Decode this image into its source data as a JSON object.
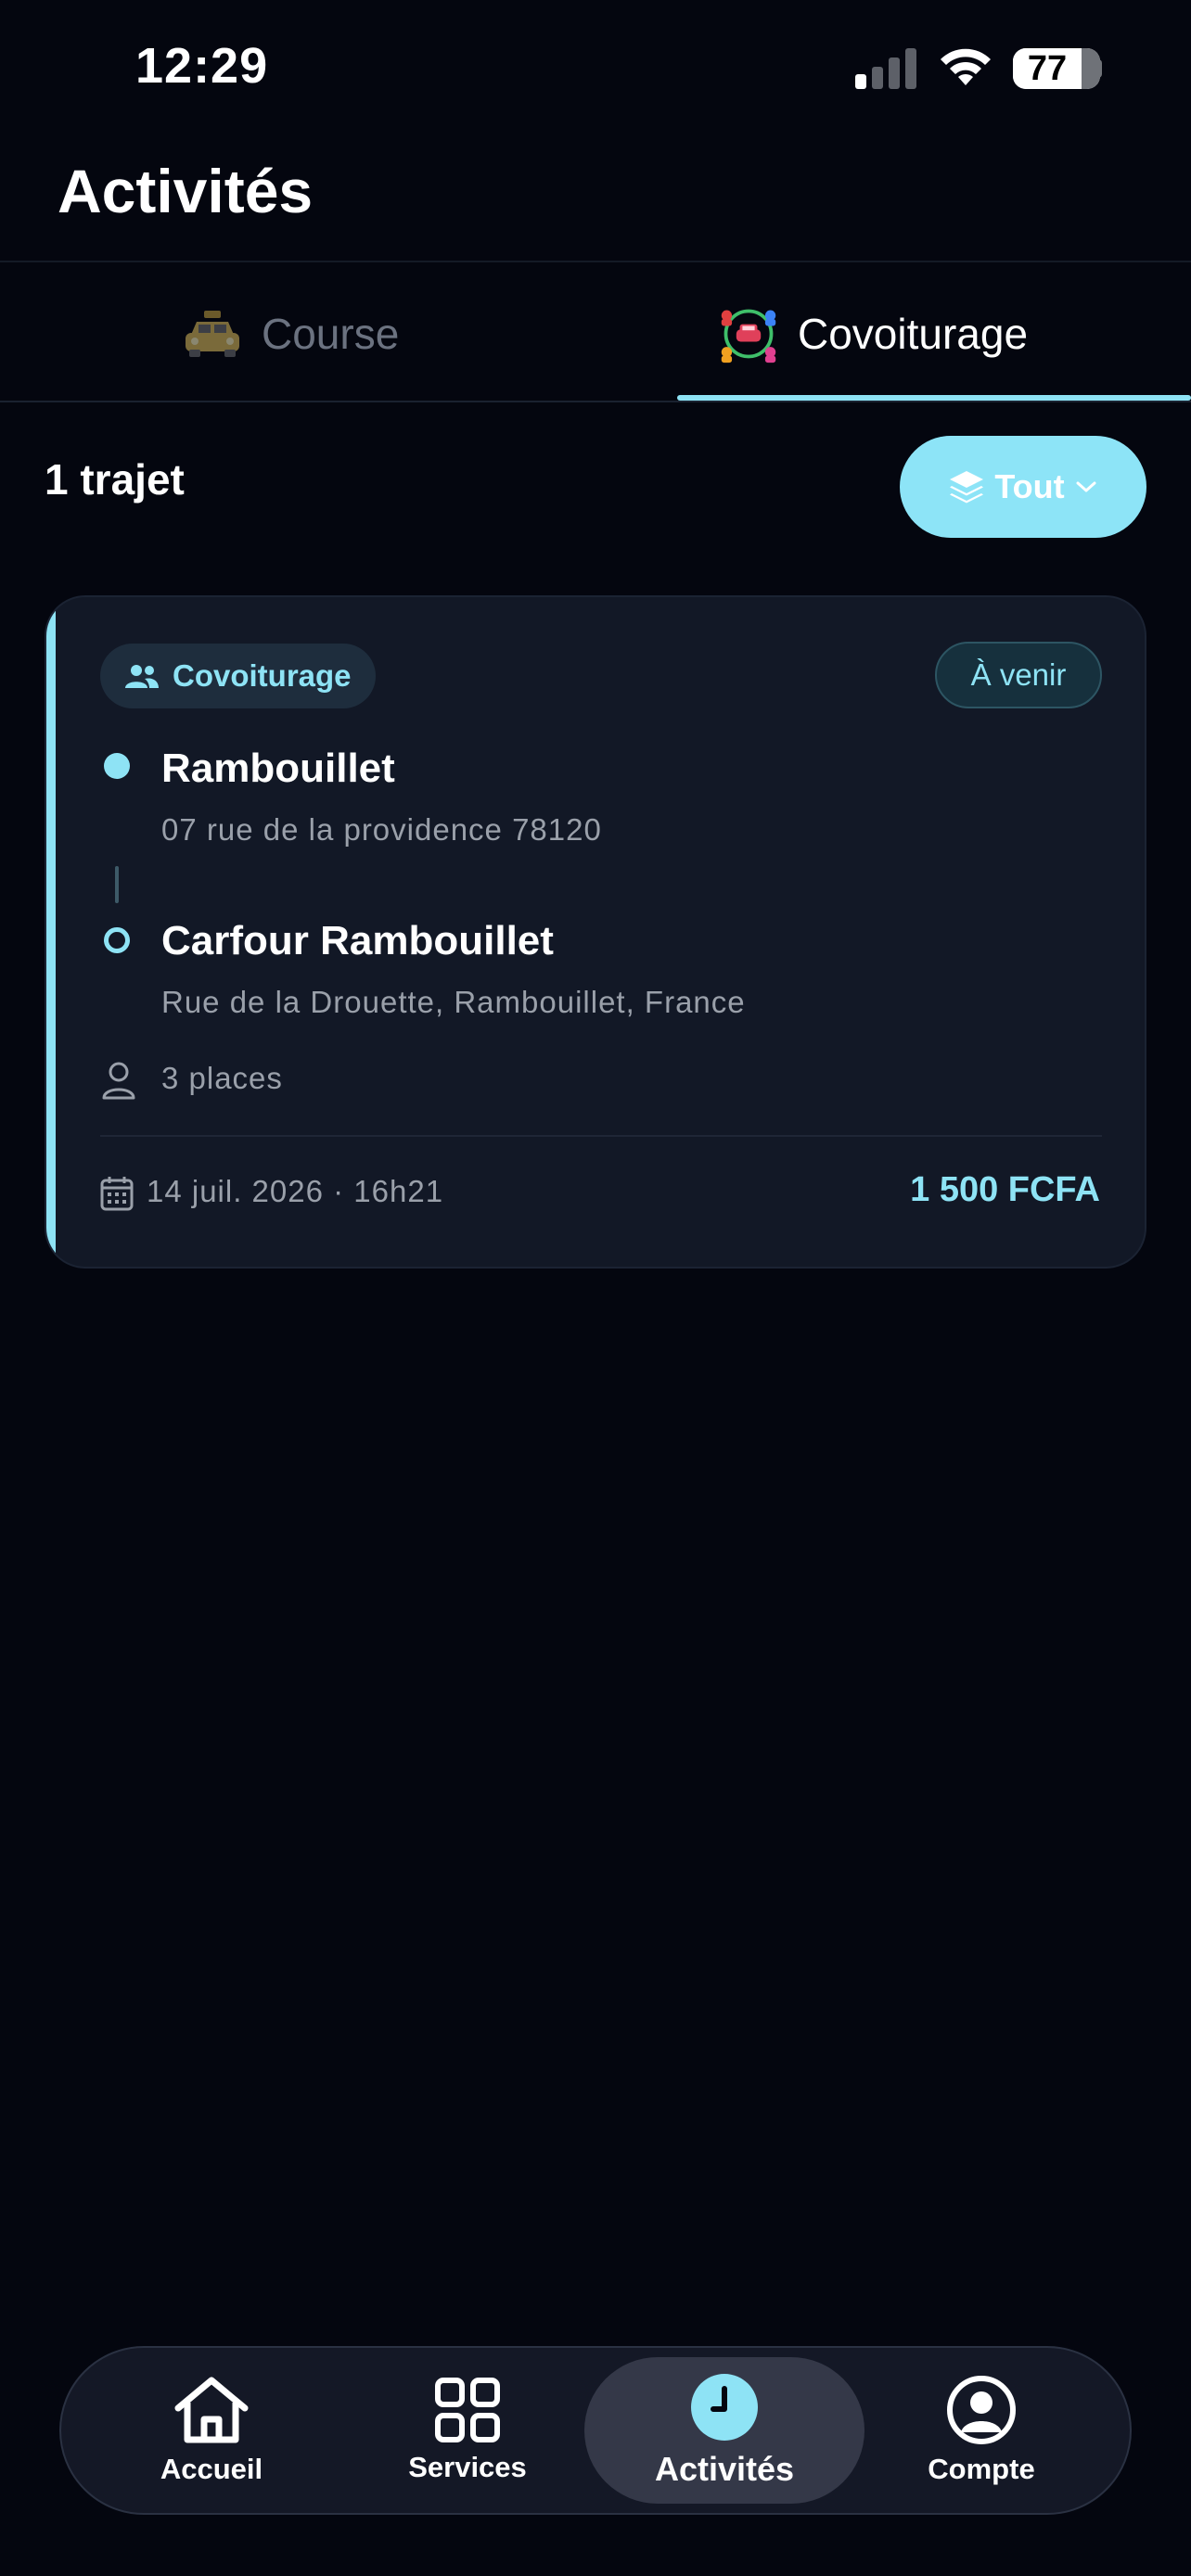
{
  "status_bar": {
    "time": "12:29",
    "battery": "77"
  },
  "page": {
    "title": "Activités"
  },
  "tabs": [
    {
      "label": "Course",
      "icon": "taxi-icon",
      "active": false
    },
    {
      "label": "Covoiturage",
      "icon": "carpool-icon",
      "active": true
    }
  ],
  "summary": {
    "count": "1 trajet",
    "filter_label": "Tout"
  },
  "trip": {
    "type_label": "Covoiturage",
    "status": "À venir",
    "from": {
      "name": "Rambouillet",
      "address": "07 rue de la providence 78120"
    },
    "to": {
      "name": "Carfour Rambouillet",
      "address": "Rue de la Drouette, Rambouillet, France"
    },
    "seats": "3 places",
    "date": "14 juil. 2026 · 16h21",
    "price": "1 500 FCFA"
  },
  "nav": [
    {
      "label": "Accueil",
      "icon": "home-icon"
    },
    {
      "label": "Services",
      "icon": "grid-icon"
    },
    {
      "label": "Activités",
      "icon": "clock-icon",
      "active": true
    },
    {
      "label": "Compte",
      "icon": "account-icon"
    }
  ],
  "colors": {
    "accent": "#8ee3f5",
    "background": "#04060f",
    "card": "#121826"
  }
}
